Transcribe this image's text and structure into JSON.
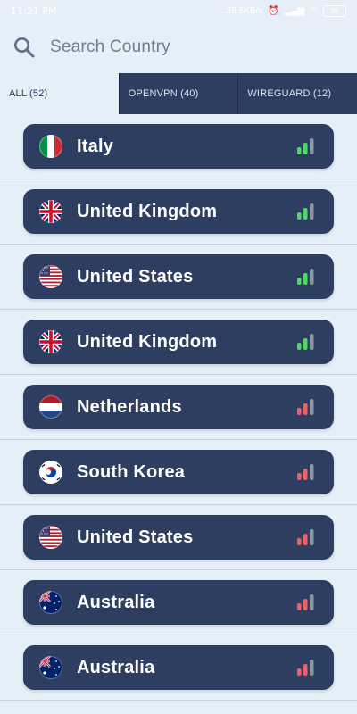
{
  "status": {
    "time": "11:21 PM",
    "network_speed": "...28.5KB/s",
    "battery": "36"
  },
  "search": {
    "placeholder": "Search Country"
  },
  "tabs": [
    {
      "label": "ALL (52)",
      "active": true
    },
    {
      "label": "OPENVPN (40)",
      "active": false
    },
    {
      "label": "WIREGUARD (12)",
      "active": false
    }
  ],
  "servers": [
    {
      "country": "Italy",
      "flag_icon": "italy-flag-icon",
      "signal": "good",
      "signal_color": "#4cd964"
    },
    {
      "country": "United Kingdom",
      "flag_icon": "uk-flag-icon",
      "signal": "good",
      "signal_color": "#4cd964"
    },
    {
      "country": "United States",
      "flag_icon": "us-flag-icon",
      "signal": "good",
      "signal_color": "#4cd964"
    },
    {
      "country": "United Kingdom",
      "flag_icon": "uk-flag-icon",
      "signal": "good",
      "signal_color": "#4cd964"
    },
    {
      "country": "Netherlands",
      "flag_icon": "netherlands-flag-icon",
      "signal": "weak",
      "signal_color": "#f06262"
    },
    {
      "country": "South Korea",
      "flag_icon": "south-korea-flag-icon",
      "signal": "weak",
      "signal_color": "#f06262"
    },
    {
      "country": "United States",
      "flag_icon": "us-flag-icon",
      "signal": "weak",
      "signal_color": "#f06262"
    },
    {
      "country": "Australia",
      "flag_icon": "australia-flag-icon",
      "signal": "weak",
      "signal_color": "#f06262"
    },
    {
      "country": "Australia",
      "flag_icon": "australia-flag-icon",
      "signal": "weak",
      "signal_color": "#f06262"
    }
  ],
  "colors": {
    "background": "#e6eef7",
    "card": "#2d3e61",
    "signal_good": "#4cd964",
    "signal_weak": "#f06262",
    "signal_inactive": "#8a98a6"
  }
}
